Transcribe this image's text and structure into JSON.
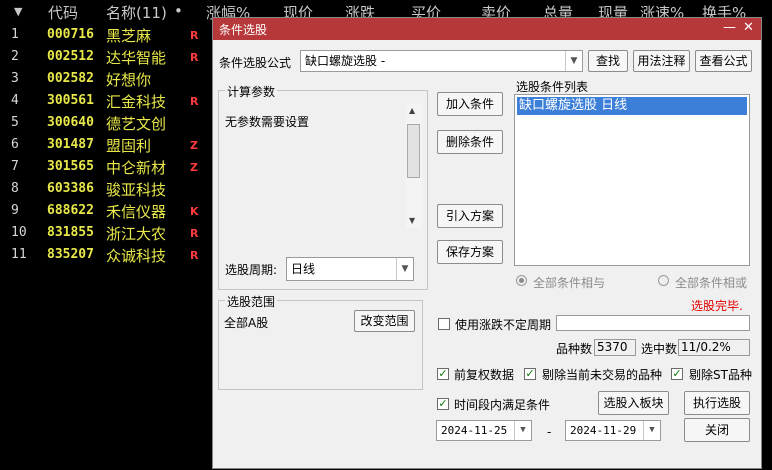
{
  "stock_list": {
    "columns": [
      "代码",
      "名称(11)",
      "•",
      "涨幅%",
      "现价",
      "涨跌",
      "买价",
      "卖价",
      "总量",
      "现量",
      "涨速%",
      "换手%"
    ],
    "rows": [
      {
        "idx": "1",
        "code": "000716",
        "name": "黑芝麻",
        "flag": "R"
      },
      {
        "idx": "2",
        "code": "002512",
        "name": "达华智能",
        "flag": "R"
      },
      {
        "idx": "3",
        "code": "002582",
        "name": "好想你",
        "flag": ""
      },
      {
        "idx": "4",
        "code": "300561",
        "name": "汇金科技",
        "flag": "R"
      },
      {
        "idx": "5",
        "code": "300640",
        "name": "德艺文创",
        "flag": ""
      },
      {
        "idx": "6",
        "code": "301487",
        "name": "盟固利",
        "flag": "Z"
      },
      {
        "idx": "7",
        "code": "301565",
        "name": "中仑新材",
        "flag": "Z"
      },
      {
        "idx": "8",
        "code": "603386",
        "name": "骏亚科技",
        "flag": ""
      },
      {
        "idx": "9",
        "code": "688622",
        "name": "禾信仪器",
        "flag": "K"
      },
      {
        "idx": "10",
        "code": "831855",
        "name": "浙江大农",
        "flag": "R"
      },
      {
        "idx": "11",
        "code": "835207",
        "name": "众诚科技",
        "flag": "R"
      }
    ]
  },
  "dialog": {
    "title": "条件选股",
    "formula_label": "条件选股公式",
    "formula_value": "缺口螺旋选股 -",
    "btn_find": "查找",
    "btn_usage": "用法注释",
    "btn_view": "查看公式",
    "params_group": "计算参数",
    "params_text": "无参数需要设置",
    "period_label": "选股周期:",
    "period_value": "日线",
    "btn_add": "加入条件",
    "btn_delete": "删除条件",
    "btn_import": "引入方案",
    "btn_save": "保存方案",
    "conditions_label": "选股条件列表",
    "conditions": [
      "缺口螺旋选股  日线"
    ],
    "radio_and": "全部条件相与",
    "radio_or": "全部条件相或",
    "status": "选股完毕.",
    "status_color": "#e00000",
    "range_group": "选股范围",
    "range_value": "全部A股",
    "btn_change_range": "改变范围",
    "uncertain_period": "使用涨跌不定周期",
    "count_label": "品种数",
    "count_value": "5370",
    "selected_label": "选中数",
    "selected_value": "11/0.2%",
    "cb_adjusted": "前复权数据",
    "cb_remove_suspended": "剔除当前未交易的品种",
    "cb_remove_st": "剔除ST品种",
    "cb_period_satisfy": "时间段内满足条件",
    "btn_to_block": "选股入板块",
    "btn_execute": "执行选股",
    "date_from": "2024-11-25",
    "date_sep": "-",
    "date_to": "2024-11-29",
    "btn_close": "关闭",
    "accent": "#b7383a"
  }
}
